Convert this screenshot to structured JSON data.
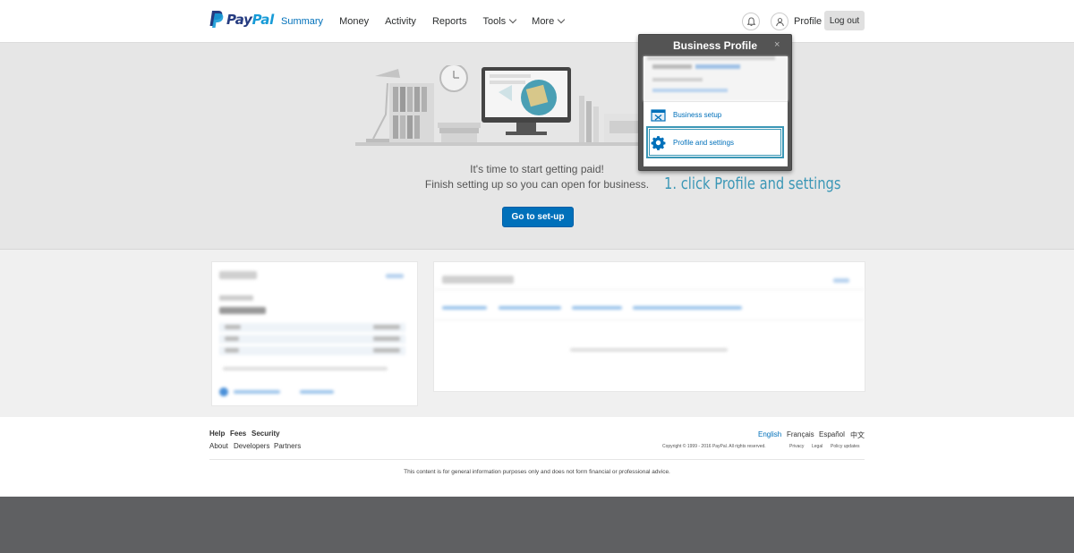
{
  "header": {
    "logo_text": "PayPal",
    "nav": [
      {
        "label": "Summary",
        "active": true
      },
      {
        "label": "Money"
      },
      {
        "label": "Activity"
      },
      {
        "label": "Reports"
      },
      {
        "label": "Tools",
        "has_menu": true
      },
      {
        "label": "More",
        "has_menu": true
      }
    ],
    "profile_label": "Profile",
    "logout_label": "Log out"
  },
  "hero": {
    "line1": "It's time to start getting paid!",
    "line2": "Finish setting up so you can open for business.",
    "button_label": "Go to set-up"
  },
  "dropdown": {
    "title": "Business Profile",
    "close_symbol": "×",
    "items": [
      {
        "label": "Business setup",
        "icon": "business-setup-icon"
      },
      {
        "label": "Profile and settings",
        "icon": "gear-icon",
        "highlighted": true
      }
    ]
  },
  "annotation": "1. click Profile and settings",
  "footer": {
    "links_row1": [
      "Help",
      "Fees",
      "Security"
    ],
    "links_row2": [
      "About",
      "Developers",
      "Partners"
    ],
    "languages": [
      "English",
      "Français",
      "Español",
      "中文"
    ],
    "copyright": "Copyright © 1999 - 2016 PayPal. All rights reserved.",
    "legal_links": [
      "Privacy",
      "Legal",
      "Policy updates"
    ],
    "disclaimer": "This content is for general information purposes only and does not form financial or professional advice."
  },
  "colors": {
    "accent": "#0070ba",
    "annotation": "#3b97b6",
    "brand_dark": "#253b80",
    "brand_light": "#179bd7"
  }
}
